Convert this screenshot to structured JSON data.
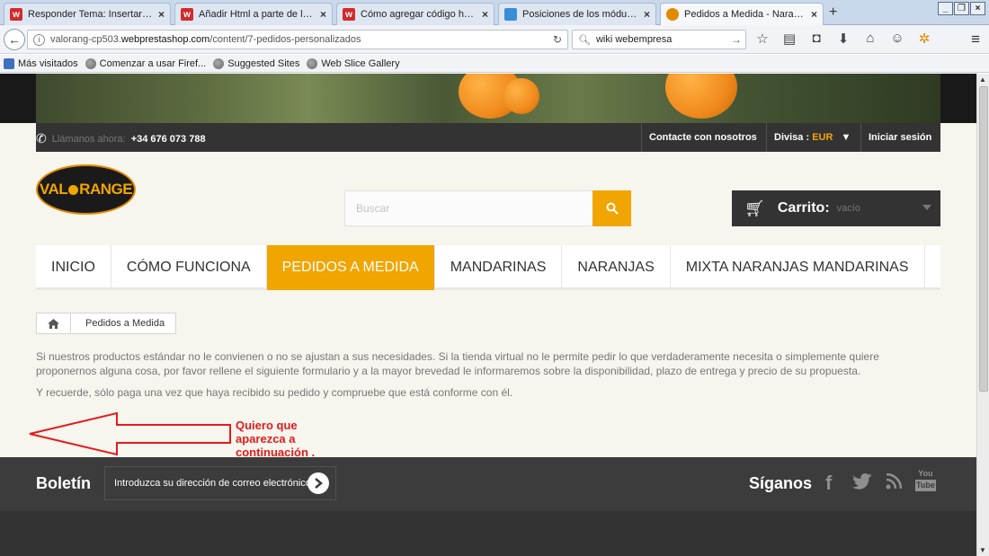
{
  "browser": {
    "tabs": [
      {
        "title": "Responder Tema: Insertar el ...",
        "favicon": "w",
        "favicon_color": "#d22b2b",
        "active": false
      },
      {
        "title": "Añadir Html a parte de la pági...",
        "favicon": "w",
        "favicon_color": "#d22b2b",
        "active": false
      },
      {
        "title": "Cómo agregar código html a ...",
        "favicon": "w",
        "favicon_color": "#d22b2b",
        "active": false
      },
      {
        "title": "Posiciones de los módulos > ...",
        "favicon": "",
        "favicon_color": "#3a8ed8",
        "active": false
      },
      {
        "title": "Pedidos a Medida - Naranjas ...",
        "favicon": "",
        "favicon_color": "#e28b00",
        "active": true
      }
    ],
    "new_tab": "+",
    "url_prefix": "valorang-cp503.",
    "url_host": "webprestashop.com",
    "url_path": "/content/7-pedidos-personalizados",
    "search_value": "wiki webempresa",
    "bookmarks": [
      "Más visitados",
      "Comenzar a usar Firef...",
      "Suggested Sites",
      "Web Slice Gallery"
    ]
  },
  "topbar": {
    "phone_label": "Llámanos ahora:",
    "phone_number": "+34 676 073 788",
    "contact": "Contacte con nosotros",
    "currency_label": "Divisa :",
    "currency_value": "EUR",
    "login": "Iniciar sesión"
  },
  "logo": {
    "text_part1": "VAL",
    "text_part2": "RANGE"
  },
  "search": {
    "placeholder": "Buscar"
  },
  "cart": {
    "label": "Carrito:",
    "status": "vacío"
  },
  "menu": {
    "items": [
      {
        "label": "INICIO",
        "active": false
      },
      {
        "label": "CÓMO FUNCIONA",
        "active": false
      },
      {
        "label": "PEDIDOS A MEDIDA",
        "active": true
      },
      {
        "label": "MANDARINAS",
        "active": false
      },
      {
        "label": "NARANJAS",
        "active": false
      },
      {
        "label": "MIXTA NARANJAS MANDARINAS",
        "active": false
      }
    ]
  },
  "breadcrumb": {
    "current": "Pedidos a Medida"
  },
  "content": {
    "paragraph1": "Si nuestros productos estándar no le convienen o no se ajustan a sus necesidades. Si la tienda virtual no le permite pedir lo que verdaderamente necesita o simplemente quiere proponernos alguna cosa, por favor rellene el siguiente formulario y a la mayor brevedad le informaremos sobre la disponibilidad, plazo de entrega y precio de su propuesta.",
    "paragraph2": "Y recuerde, sólo paga una vez que haya recibido su pedido y compruebe que está conforme con él."
  },
  "annotation": {
    "text": "Quiero que aparezca a continuación ."
  },
  "footer": {
    "newsletter_title": "Boletín",
    "newsletter_placeholder": "Introduzca su dirección de correo electrónico",
    "follow_title": "Síganos",
    "social": [
      "facebook",
      "twitter",
      "rss",
      "youtube"
    ]
  },
  "colors": {
    "accent": "#f0a500",
    "dark": "#333333",
    "annotation": "#e41b1b"
  }
}
